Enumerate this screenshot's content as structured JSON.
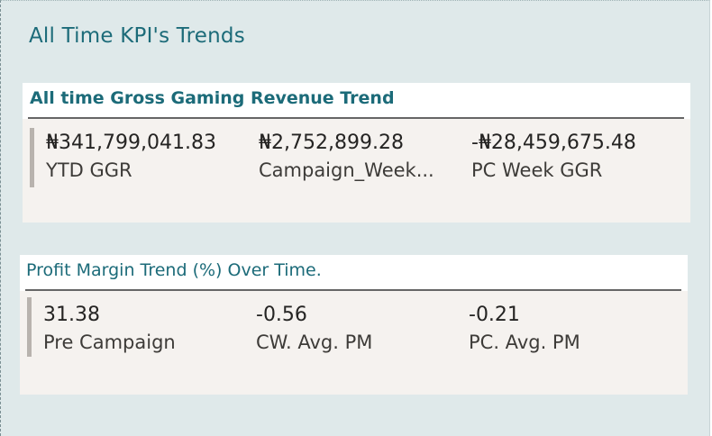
{
  "page": {
    "title": "All Time KPI's Trends"
  },
  "cards": {
    "ggr": {
      "title": "All time Gross Gaming Revenue Trend",
      "kpis": [
        {
          "value": "₦341,799,041.83",
          "label": "YTD GGR"
        },
        {
          "value": "₦2,752,899.28",
          "label": "Campaign_Week..."
        },
        {
          "value": "-₦28,459,675.48",
          "label": "PC Week GGR"
        }
      ]
    },
    "pm": {
      "title": "Profit Margin Trend (%) Over Time.",
      "kpis": [
        {
          "value": "31.38",
          "label": "Pre Campaign"
        },
        {
          "value": "-0.56",
          "label": "CW. Avg. PM"
        },
        {
          "value": "-0.21",
          "label": "PC. Avg. PM"
        }
      ]
    }
  },
  "colors": {
    "panel_bg": "#dfe9ea",
    "title_teal": "#1c6b79",
    "card_bg": "#f5f2ef",
    "accent_bar": "#b8b3ae"
  }
}
